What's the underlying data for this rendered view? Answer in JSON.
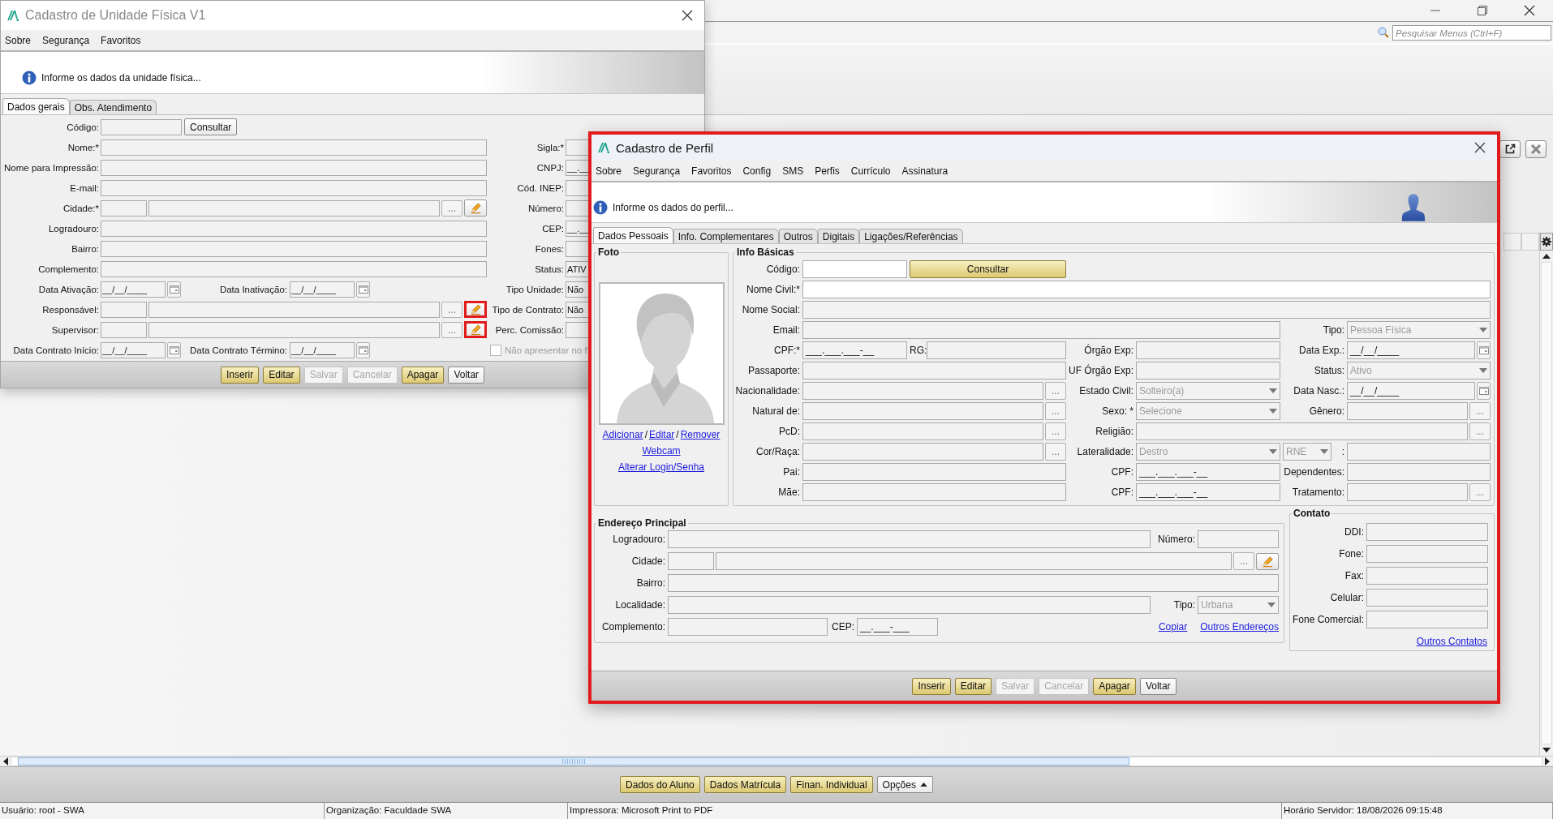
{
  "app": {
    "search": {
      "placeholder": "Pesquisar Menus (Ctrl+F)"
    },
    "bottom_buttons": [
      {
        "label": "Dados do Aluno",
        "kind": "accent"
      },
      {
        "label": "Dados Matrícula",
        "kind": "accent"
      },
      {
        "label": "Finan. Individual",
        "kind": "accent"
      },
      {
        "label": "Opções",
        "kind": "menu"
      }
    ],
    "status_bar": [
      "Usuário: root - SWA",
      "Organização: Faculdade SWA",
      "Impressora: Microsoft Print to PDF",
      "Horário Servidor: 18/08/2026 09:15:48"
    ]
  },
  "unit_window": {
    "title": "Cadastro de Unidade Física V1",
    "menu": [
      "Sobre",
      "Segurança",
      "Favoritos"
    ],
    "info": "Informe os dados da unidade física...",
    "tabs": [
      {
        "label": "Dados gerais",
        "selected": true
      },
      {
        "label": "Obs. Atendimento",
        "selected": false
      }
    ],
    "rows": [
      {
        "left": [
          {
            "kind": "label",
            "text": "Código:"
          },
          {
            "kind": "input",
            "disabled": true
          },
          {
            "kind": "button",
            "label": "Consultar",
            "accent": false
          }
        ]
      },
      {
        "left": [
          {
            "kind": "label",
            "text": "Nome:*"
          },
          {
            "kind": "input",
            "disabled": true
          }
        ],
        "right": [
          {
            "kind": "label",
            "text": "Sigla:*"
          },
          {
            "kind": "input",
            "disabled": true
          }
        ]
      },
      {
        "left": [
          {
            "kind": "label",
            "text": "Nome para Impressão:"
          },
          {
            "kind": "input",
            "disabled": true
          }
        ],
        "right": [
          {
            "kind": "label",
            "text": "CNPJ:"
          },
          {
            "kind": "input",
            "value": "__.__",
            "disabled": true
          }
        ]
      },
      {
        "left": [
          {
            "kind": "label",
            "text": "E-mail:"
          },
          {
            "kind": "input",
            "disabled": true
          }
        ],
        "right": [
          {
            "kind": "label",
            "text": "Cód. INEP:"
          },
          {
            "kind": "input",
            "disabled": true
          }
        ]
      },
      {
        "left": [
          {
            "kind": "label",
            "text": "Cidade:*"
          },
          {
            "kind": "lookup",
            "button_text": "...",
            "edit": true,
            "highlighted": false,
            "disabled": true
          }
        ],
        "right": [
          {
            "kind": "label",
            "text": "Número:"
          },
          {
            "kind": "input",
            "disabled": true
          }
        ]
      },
      {
        "left": [
          {
            "kind": "label",
            "text": "Logradouro:"
          },
          {
            "kind": "input",
            "disabled": true
          }
        ],
        "right": [
          {
            "kind": "label",
            "text": "CEP:"
          },
          {
            "kind": "input",
            "value": "__.__",
            "disabled": true
          }
        ]
      },
      {
        "left": [
          {
            "kind": "label",
            "text": "Bairro:"
          },
          {
            "kind": "input",
            "disabled": true
          }
        ],
        "right": [
          {
            "kind": "label",
            "text": "Fones:"
          },
          {
            "kind": "input",
            "disabled": true
          }
        ]
      },
      {
        "left": [
          {
            "kind": "label",
            "text": "Complemento:"
          },
          {
            "kind": "input",
            "disabled": true
          }
        ],
        "right": [
          {
            "kind": "label",
            "text": "Status:"
          },
          {
            "kind": "input",
            "value": "ATIV",
            "disabled": true
          }
        ]
      },
      {
        "left": [
          {
            "kind": "label",
            "text": "Data Ativação:"
          },
          {
            "kind": "date",
            "value": "__/__/____",
            "disabled": true
          },
          {
            "kind": "label",
            "text": "Data Inativação:"
          },
          {
            "kind": "date",
            "value": "__/__/____",
            "disabled": true
          }
        ],
        "right": [
          {
            "kind": "label",
            "text": "Tipo Unidade:"
          },
          {
            "kind": "input",
            "value": "Não",
            "disabled": true
          }
        ]
      },
      {
        "left": [
          {
            "kind": "label",
            "text": "Responsável:"
          },
          {
            "kind": "lookup",
            "button_text": "...",
            "edit": true,
            "highlighted": true,
            "disabled": true
          }
        ],
        "right": [
          {
            "kind": "label",
            "text": "Tipo de Contrato:"
          },
          {
            "kind": "input",
            "value": "Não",
            "disabled": true
          }
        ]
      },
      {
        "left": [
          {
            "kind": "label",
            "text": "Supervisor:"
          },
          {
            "kind": "lookup",
            "button_text": "...",
            "edit": true,
            "highlighted": true,
            "disabled": true
          }
        ],
        "right": [
          {
            "kind": "label",
            "text": "Perc. Comissão:"
          },
          {
            "kind": "input",
            "disabled": true
          }
        ]
      },
      {
        "left": [
          {
            "kind": "label",
            "text": "Data Contrato Início:"
          },
          {
            "kind": "date",
            "value": "__/__/____",
            "disabled": true
          },
          {
            "kind": "label",
            "text": "Data Contrato Término:"
          },
          {
            "kind": "date",
            "value": "__/__/____",
            "disabled": true
          }
        ],
        "right": [
          {
            "kind": "checkbox",
            "label": "Não apresentar no f",
            "checked": false
          }
        ]
      }
    ],
    "buttons": [
      {
        "label": "Inserir",
        "accent": true,
        "disabled": false
      },
      {
        "label": "Editar",
        "accent": true,
        "disabled": false
      },
      {
        "label": "Salvar",
        "accent": false,
        "disabled": true
      },
      {
        "label": "Cancelar",
        "accent": false,
        "disabled": true
      },
      {
        "label": "Apagar",
        "accent": true,
        "disabled": false
      },
      {
        "label": "Voltar",
        "accent": false,
        "disabled": false
      }
    ]
  },
  "profile_dialog": {
    "title": "Cadastro de Perfil",
    "highlighted": true,
    "menu": [
      "Sobre",
      "Segurança",
      "Favoritos",
      "Config",
      "SMS",
      "Perfis",
      "Currículo",
      "Assinatura"
    ],
    "info": "Informe os dados do perfil...",
    "tabs": [
      {
        "label": "Dados Pessoais",
        "selected": true
      },
      {
        "label": "Info. Complementares",
        "selected": false
      },
      {
        "label": "Outros",
        "selected": false
      },
      {
        "label": "Digitais",
        "selected": false
      },
      {
        "label": "Ligações/Referências",
        "selected": false
      }
    ],
    "photo": {
      "title": "Foto",
      "link_lines": [
        [
          {
            "kind": "link",
            "text": "Adicionar"
          },
          {
            "kind": "sep",
            "text": "/"
          },
          {
            "kind": "link",
            "text": "Editar"
          },
          {
            "kind": "sep",
            "text": "/"
          },
          {
            "kind": "link",
            "text": "Remover"
          }
        ],
        [
          {
            "kind": "link",
            "text": "Webcam"
          }
        ],
        [
          {
            "kind": "link",
            "text": "Alterar Login/Senha"
          }
        ]
      ]
    },
    "basic_info": {
      "title": "Info Básicas",
      "rows": [
        [
          {
            "kind": "label",
            "text": "Código:"
          },
          {
            "kind": "input",
            "disabled": false
          },
          {
            "kind": "button",
            "label": "Consultar",
            "accent": true
          },
          null,
          null,
          null,
          null,
          null,
          null
        ],
        [
          {
            "kind": "label",
            "text": "Nome Civil:*"
          },
          {
            "kind": "input",
            "disabled": false
          },
          null,
          null,
          null,
          null,
          null,
          null,
          null
        ],
        [
          {
            "kind": "label",
            "text": "Nome Social:"
          },
          {
            "kind": "input",
            "disabled": true
          },
          null,
          null,
          null,
          null,
          null,
          null,
          null
        ],
        [
          {
            "kind": "label",
            "text": "Email:"
          },
          {
            "kind": "input",
            "disabled": true
          },
          null,
          null,
          null,
          null,
          {
            "kind": "label",
            "text": "Tipo:"
          },
          null,
          {
            "kind": "select",
            "value": "Pessoa Física",
            "disabled": true
          }
        ],
        [
          {
            "kind": "label",
            "text": "CPF:*"
          },
          {
            "kind": "input",
            "value": "___.___.___-__",
            "disabled": true
          },
          {
            "kind": "label",
            "text": "RG:"
          },
          {
            "kind": "input",
            "disabled": true
          },
          {
            "kind": "label",
            "text": "Órgão Exp:"
          },
          {
            "kind": "input",
            "disabled": true
          },
          {
            "kind": "label",
            "text": "Data Exp.:"
          },
          null,
          {
            "kind": "date",
            "value": "__/__/____",
            "disabled": true
          }
        ],
        [
          {
            "kind": "label",
            "text": "Passaporte:"
          },
          {
            "kind": "input",
            "disabled": true
          },
          null,
          null,
          {
            "kind": "label",
            "text": "UF Órgão Exp:"
          },
          {
            "kind": "input",
            "disabled": true
          },
          {
            "kind": "label",
            "text": "Status:"
          },
          null,
          {
            "kind": "select",
            "value": "Ativo",
            "disabled": true
          }
        ],
        [
          {
            "kind": "label",
            "text": "Nacionalidade:"
          },
          {
            "kind": "input",
            "button_text": "...",
            "disabled": true
          },
          null,
          null,
          {
            "kind": "label",
            "text": "Estado Civil:"
          },
          {
            "kind": "select",
            "value": "Solteiro(a)",
            "disabled": true
          },
          {
            "kind": "label",
            "text": "Data Nasc.:"
          },
          null,
          {
            "kind": "date",
            "value": "__/__/____",
            "disabled": true
          }
        ],
        [
          {
            "kind": "label",
            "text": "Natural de:"
          },
          {
            "kind": "input",
            "button_text": "...",
            "disabled": true
          },
          null,
          null,
          {
            "kind": "label",
            "text": "Sexo: *"
          },
          {
            "kind": "select",
            "value": "Selecione",
            "disabled": true
          },
          {
            "kind": "label",
            "text": "Gênero:"
          },
          null,
          {
            "kind": "input",
            "button_text": "...",
            "disabled": true
          }
        ],
        [
          {
            "kind": "label",
            "text": "PcD:"
          },
          {
            "kind": "input",
            "button_text": "...",
            "disabled": true
          },
          null,
          null,
          {
            "kind": "label",
            "text": "Religião:"
          },
          {
            "kind": "input",
            "button_text": "...",
            "disabled": true
          },
          null,
          null,
          null
        ],
        [
          {
            "kind": "label",
            "text": "Cor/Raça:"
          },
          {
            "kind": "input",
            "button_text": "...",
            "disabled": true
          },
          null,
          null,
          {
            "kind": "label",
            "text": "Lateralidade:"
          },
          {
            "kind": "select",
            "value": "Destro",
            "disabled": true
          },
          {
            "kind": "select",
            "value": "RNE",
            "disabled": true
          },
          {
            "kind": "label",
            "text": ":"
          },
          {
            "kind": "input",
            "disabled": true
          }
        ],
        [
          {
            "kind": "label",
            "text": "Pai:"
          },
          {
            "kind": "input",
            "disabled": true
          },
          null,
          null,
          {
            "kind": "label",
            "text": "CPF:"
          },
          {
            "kind": "input",
            "value": "___.___.___-__",
            "disabled": true
          },
          {
            "kind": "label",
            "text": "Dependentes:"
          },
          null,
          {
            "kind": "input",
            "disabled": true
          }
        ],
        [
          {
            "kind": "label",
            "text": "Mãe:"
          },
          {
            "kind": "input",
            "disabled": true
          },
          null,
          null,
          {
            "kind": "label",
            "text": "CPF:"
          },
          {
            "kind": "input",
            "value": "___.___.___-__",
            "disabled": true
          },
          {
            "kind": "label",
            "text": "Tratamento:"
          },
          null,
          {
            "kind": "input",
            "button_text": "...",
            "disabled": true
          }
        ]
      ]
    },
    "address": {
      "title": "Endereço Principal",
      "rows": [
        [
          {
            "kind": "label",
            "text": "Logradouro:"
          },
          {
            "kind": "input",
            "disabled": true
          },
          null,
          null,
          null,
          {
            "kind": "label",
            "text": "Número:"
          },
          {
            "kind": "input",
            "disabled": true
          }
        ],
        [
          {
            "kind": "label",
            "text": "Cidade:"
          },
          {
            "kind": "lookup",
            "button_text": "...",
            "edit": true,
            "highlighted": false,
            "disabled": true
          },
          null,
          null,
          null,
          null,
          null
        ],
        [
          {
            "kind": "label",
            "text": "Bairro:"
          },
          {
            "kind": "input",
            "disabled": true
          },
          null,
          null,
          null,
          null,
          null
        ],
        [
          {
            "kind": "label",
            "text": "Localidade:"
          },
          {
            "kind": "input",
            "disabled": true
          },
          null,
          null,
          null,
          {
            "kind": "label",
            "text": "Tipo:"
          },
          {
            "kind": "select",
            "value": "Urbana",
            "disabled": true
          }
        ],
        [
          {
            "kind": "label",
            "text": "Complemento:"
          },
          {
            "kind": "input",
            "disabled": true
          },
          {
            "kind": "label",
            "text": "CEP:"
          },
          {
            "kind": "input",
            "value": "__.___-___",
            "disabled": true
          },
          {
            "kind": "links",
            "items": [
              {
                "kind": "link",
                "text": "Copiar"
              },
              {
                "kind": "link",
                "text": "Outros Endereços"
              }
            ]
          },
          null,
          null
        ]
      ]
    },
    "contact": {
      "title": "Contato",
      "rows": [
        [
          {
            "kind": "label",
            "text": "DDI:"
          },
          {
            "kind": "input",
            "disabled": true
          }
        ],
        [
          {
            "kind": "label",
            "text": "Fone:"
          },
          {
            "kind": "input",
            "disabled": true
          }
        ],
        [
          {
            "kind": "label",
            "text": "Fax:"
          },
          {
            "kind": "input",
            "disabled": true
          }
        ],
        [
          {
            "kind": "label",
            "text": "Celular:"
          },
          {
            "kind": "input",
            "disabled": true
          }
        ],
        [
          {
            "kind": "label",
            "text": "Fone Comercial:"
          },
          {
            "kind": "input",
            "disabled": true
          }
        ]
      ],
      "link": "Outros Contatos"
    },
    "buttons": [
      {
        "label": "Inserir",
        "accent": true,
        "disabled": false
      },
      {
        "label": "Editar",
        "accent": true,
        "disabled": false
      },
      {
        "label": "Salvar",
        "accent": false,
        "disabled": true
      },
      {
        "label": "Cancelar",
        "accent": false,
        "disabled": true
      },
      {
        "label": "Apagar",
        "accent": true,
        "disabled": false
      },
      {
        "label": "Voltar",
        "accent": false,
        "disabled": false
      }
    ]
  }
}
